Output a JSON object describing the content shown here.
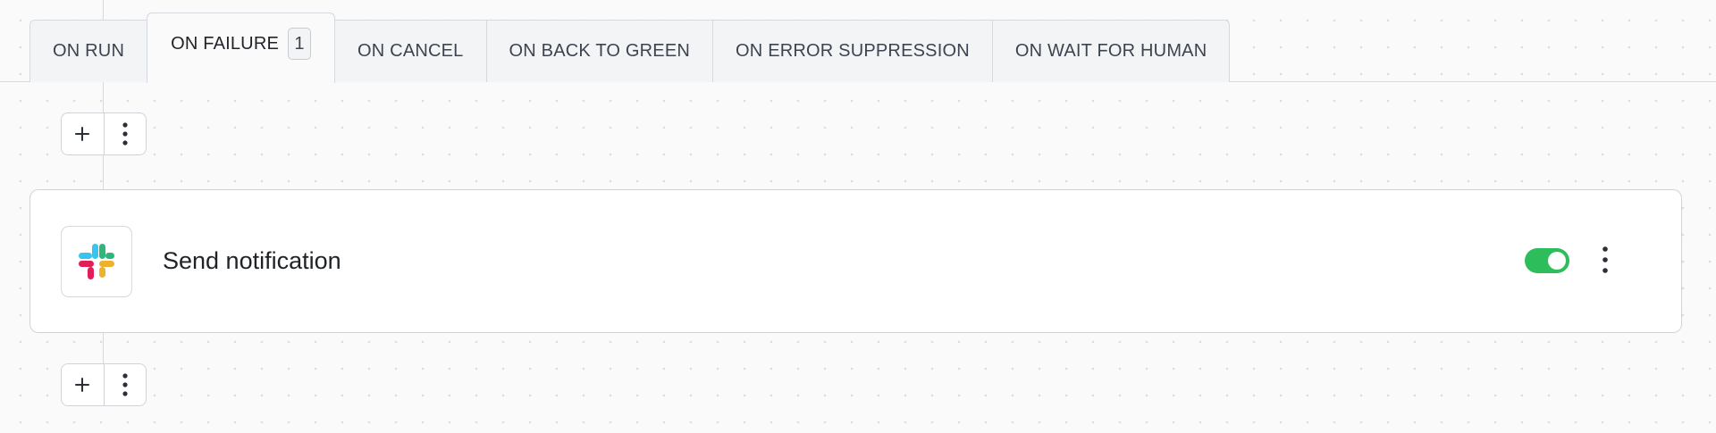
{
  "tabs": [
    {
      "label": "ON RUN",
      "active": false
    },
    {
      "label": "ON FAILURE",
      "active": true,
      "badge": "1"
    },
    {
      "label": "ON CANCEL",
      "active": false
    },
    {
      "label": "ON BACK TO GREEN",
      "active": false
    },
    {
      "label": "ON ERROR SUPPRESSION",
      "active": false
    },
    {
      "label": "ON WAIT FOR HUMAN",
      "active": false
    }
  ],
  "step_card": {
    "title": "Send notification",
    "icon": "slack-logo-icon",
    "enabled": true
  },
  "colors": {
    "toggle_on": "#2dbd5a",
    "slack_blue": "#36c5f0",
    "slack_green": "#2eb67d",
    "slack_yellow": "#ecb22e",
    "slack_red": "#e01e5a"
  }
}
